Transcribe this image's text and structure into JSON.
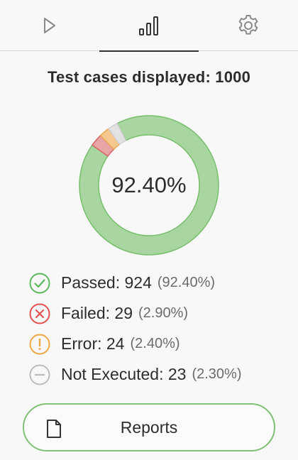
{
  "tabs": [
    {
      "name": "run",
      "icon": "play-icon"
    },
    {
      "name": "statistics",
      "icon": "bar-chart-icon",
      "active": true
    },
    {
      "name": "settings",
      "icon": "gear-icon"
    }
  ],
  "summary": {
    "title": "Test cases displayed: 1000",
    "center_label": "92.40%"
  },
  "legend": [
    {
      "label": "Passed: 924",
      "pct": "(92.40%)",
      "icon": "check-circle-icon",
      "color": "#5cb85c"
    },
    {
      "label": "Failed: 29",
      "pct": "(2.90%)",
      "icon": "x-circle-icon",
      "color": "#e05252"
    },
    {
      "label": "Error: 24",
      "pct": "(2.40%)",
      "icon": "exclamation-circle-icon",
      "color": "#f0a843"
    },
    {
      "label": "Not Executed: 23",
      "pct": "(2.30%)",
      "icon": "minus-circle-icon",
      "color": "#bdbdbd"
    }
  ],
  "chart_data": {
    "type": "pie",
    "categories": [
      "Passed",
      "Failed",
      "Error",
      "Not Executed"
    ],
    "values": [
      924,
      29,
      24,
      23
    ],
    "colors": [
      "#a8d5a0",
      "#e9a5a5",
      "#f5c890",
      "#e2e2e2"
    ],
    "stroke_colors": [
      "#78bf6c",
      "#d86464",
      "#eda650",
      "#cfcfcf"
    ],
    "center_text": "92.40%"
  },
  "reports": {
    "label": "Reports",
    "icon": "document-icon",
    "border_color": "#7fc274"
  }
}
